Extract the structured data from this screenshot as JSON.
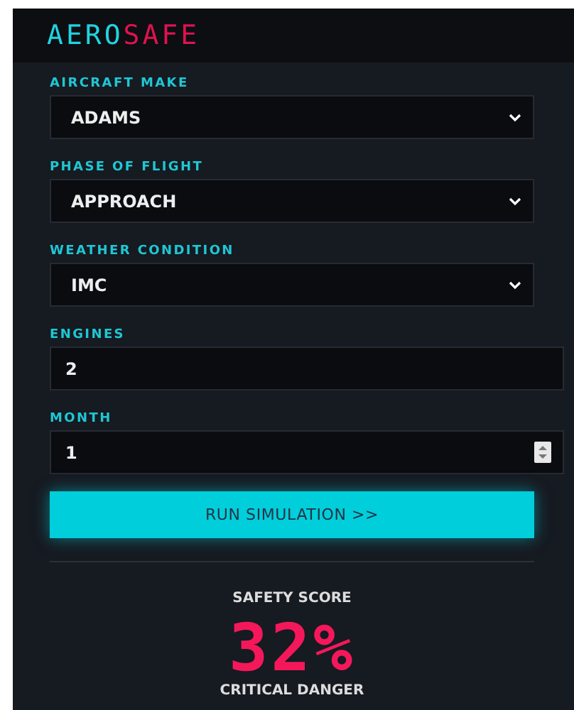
{
  "logo": {
    "part_1": "AERO",
    "part_2": "SAFE"
  },
  "fields": [
    {
      "label": "AIRCRAFT MAKE",
      "kind": "select",
      "value": "ADAMS"
    },
    {
      "label": "PHASE OF FLIGHT",
      "kind": "select",
      "value": "APPROACH"
    },
    {
      "label": "WEATHER CONDITION",
      "kind": "select",
      "value": "IMC"
    },
    {
      "label": "ENGINES",
      "kind": "text",
      "value": "2"
    },
    {
      "label": "MONTH",
      "kind": "number",
      "value": "1"
    }
  ],
  "run_button": "RUN SIMULATION >>",
  "result": {
    "title": "SAFETY SCORE",
    "score": "32%",
    "verdict": "CRITICAL DANGER"
  }
}
